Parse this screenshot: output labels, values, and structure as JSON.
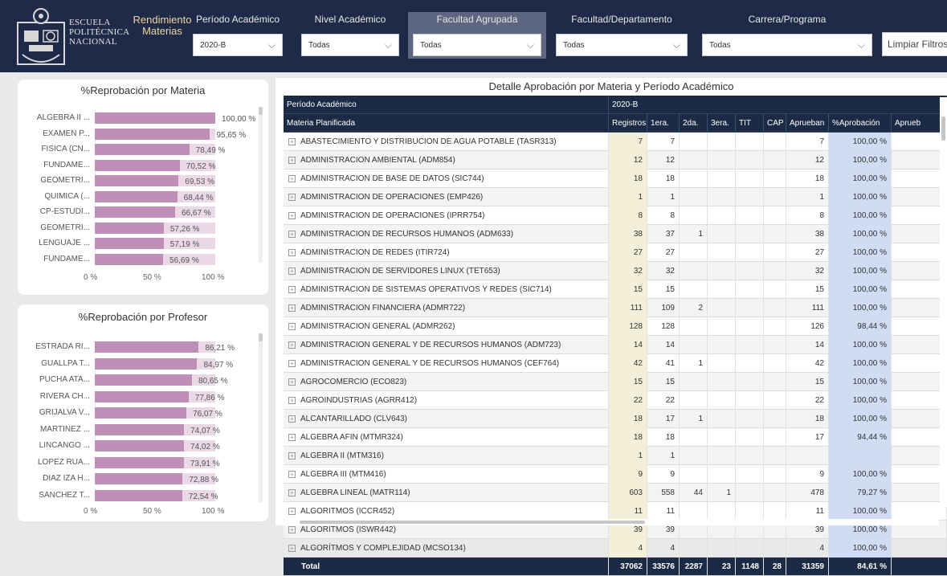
{
  "header": {
    "logo_lines": [
      "ESCUELA",
      "POLITÉCNICA",
      "NACIONAL"
    ],
    "report_title": "Rendimiento Materias",
    "filters": [
      {
        "label": "Período Académico",
        "value": "2020-B"
      },
      {
        "label": "Nivel Académico",
        "value": "Todas"
      },
      {
        "label": "Facultad Agrupada",
        "value": "Todas"
      },
      {
        "label": "Facultad/Departamento",
        "value": "Todas"
      },
      {
        "label": "Carrera/Programa",
        "value": "Todas"
      }
    ],
    "clear_button": "Limpiar Filtros"
  },
  "materia_chart": {
    "title": "%Reprobación por Materia",
    "items": [
      {
        "label": "ALGEBRA II ...",
        "value": 100.0,
        "display": "100,00 %"
      },
      {
        "label": "EXAMEN P...",
        "value": 95.65,
        "display": "95,65 %"
      },
      {
        "label": "FISICA (CN...",
        "value": 78.49,
        "display": "78,49 %"
      },
      {
        "label": "FUNDAME...",
        "value": 70.52,
        "display": "70,52 %"
      },
      {
        "label": "GEOMETRI...",
        "value": 69.53,
        "display": "69,53 %"
      },
      {
        "label": "QUIMICA (...",
        "value": 68.44,
        "display": "68,44 %"
      },
      {
        "label": "CP-ESTUDI...",
        "value": 66.67,
        "display": "66,67 %"
      },
      {
        "label": "GEOMETRI...",
        "value": 57.26,
        "display": "57,26 %"
      },
      {
        "label": "LENGUAJE ...",
        "value": 57.19,
        "display": "57,19 %"
      },
      {
        "label": "FUNDAME...",
        "value": 56.69,
        "display": "56,69 %"
      }
    ],
    "axis": [
      "0 %",
      "50 %",
      "100 %"
    ]
  },
  "profesor_chart": {
    "title": "%Reprobación por Profesor",
    "items": [
      {
        "label": "ESTRADA RI...",
        "value": 86.21,
        "display": "86,21 %"
      },
      {
        "label": "GUALLPA T...",
        "value": 84.97,
        "display": "84,97 %"
      },
      {
        "label": "PUCHA ATA...",
        "value": 80.65,
        "display": "80,65 %"
      },
      {
        "label": "RIVERA CH...",
        "value": 77.86,
        "display": "77,86 %"
      },
      {
        "label": "GRIJALVA V...",
        "value": 76.07,
        "display": "76,07 %"
      },
      {
        "label": "MARTINEZ ...",
        "value": 74.07,
        "display": "74,07 %"
      },
      {
        "label": "LINCANGO ...",
        "value": 74.02,
        "display": "74,02 %"
      },
      {
        "label": "LOPEZ RUA...",
        "value": 73.91,
        "display": "73,91 %"
      },
      {
        "label": "DIAZ IZA H...",
        "value": 72.88,
        "display": "72,88 %"
      },
      {
        "label": "SANCHEZ T...",
        "value": 72.54,
        "display": "72,54 %"
      }
    ],
    "axis": [
      "0 %",
      "50 %",
      "100 %"
    ]
  },
  "table": {
    "title": "Detalle Aprobación por Materia y Período Académico",
    "period_header": "Período Académico",
    "period_value": "2020-B",
    "columns": [
      "Materia Planificada",
      "Registros",
      "1era.",
      "2da.",
      "3era.",
      "TIT",
      "CAP",
      "Aprueban",
      "%Aprobación",
      "Aprueb"
    ],
    "rows": [
      [
        "ABASTECIMIENTO Y DISTRIBUCION DE AGUA POTABLE (TASR313)",
        "7",
        "7",
        "",
        "",
        "",
        "",
        "7",
        "100,00 %"
      ],
      [
        "ADMINISTRACION AMBIENTAL (ADM854)",
        "12",
        "12",
        "",
        "",
        "",
        "",
        "12",
        "100,00 %"
      ],
      [
        "ADMINISTRACION DE BASE DE DATOS (SIC744)",
        "18",
        "18",
        "",
        "",
        "",
        "",
        "18",
        "100,00 %"
      ],
      [
        "ADMINISTRACION DE OPERACIONES (EMP426)",
        "1",
        "1",
        "",
        "",
        "",
        "",
        "1",
        "100,00 %"
      ],
      [
        "ADMINISTRACION DE OPERACIONES (IPRR754)",
        "8",
        "8",
        "",
        "",
        "",
        "",
        "8",
        "100,00 %"
      ],
      [
        "ADMINISTRACION DE RECURSOS HUMANOS (ADM633)",
        "38",
        "37",
        "1",
        "",
        "",
        "",
        "38",
        "100,00 %"
      ],
      [
        "ADMINISTRACION DE REDES (ITIR724)",
        "27",
        "27",
        "",
        "",
        "",
        "",
        "27",
        "100,00 %"
      ],
      [
        "ADMINISTRACION DE SERVIDORES LINUX (TET653)",
        "32",
        "32",
        "",
        "",
        "",
        "",
        "32",
        "100,00 %"
      ],
      [
        "ADMINISTRACION DE SISTEMAS OPERATIVOS Y REDES (SIC714)",
        "15",
        "15",
        "",
        "",
        "",
        "",
        "15",
        "100,00 %"
      ],
      [
        "ADMINISTRACION FINANCIERA (ADMR722)",
        "111",
        "109",
        "2",
        "",
        "",
        "",
        "111",
        "100,00 %"
      ],
      [
        "ADMINISTRACION GENERAL (ADMR262)",
        "128",
        "128",
        "",
        "",
        "",
        "",
        "126",
        "98,44 %"
      ],
      [
        "ADMINISTRACION GENERAL Y DE RECURSOS HUMANOS (ADM723)",
        "14",
        "14",
        "",
        "",
        "",
        "",
        "14",
        "100,00 %"
      ],
      [
        "ADMINISTRACION GENERAL Y DE RECURSOS HUMANOS (CEF764)",
        "42",
        "41",
        "1",
        "",
        "",
        "",
        "42",
        "100,00 %"
      ],
      [
        "AGROCOMERCIO (ECO823)",
        "15",
        "15",
        "",
        "",
        "",
        "",
        "15",
        "100,00 %"
      ],
      [
        "AGROINDUSTRIAS (AGRR412)",
        "22",
        "22",
        "",
        "",
        "",
        "",
        "22",
        "100,00 %"
      ],
      [
        "ALCANTARILLADO (CLV643)",
        "18",
        "17",
        "1",
        "",
        "",
        "",
        "18",
        "100,00 %"
      ],
      [
        "ALGEBRA AFIN (MTMR324)",
        "18",
        "18",
        "",
        "",
        "",
        "",
        "17",
        "94,44 %"
      ],
      [
        "ALGEBRA II (MTM316)",
        "1",
        "1",
        "",
        "",
        "",
        "",
        "",
        ""
      ],
      [
        "ALGEBRA III (MTM416)",
        "9",
        "9",
        "",
        "",
        "",
        "",
        "9",
        "100,00 %"
      ],
      [
        "ALGEBRA LINEAL (MATR114)",
        "603",
        "558",
        "44",
        "1",
        "",
        "",
        "478",
        "79,27 %"
      ],
      [
        "ALGORITMOS (ICCR452)",
        "11",
        "11",
        "",
        "",
        "",
        "",
        "11",
        "100,00 %"
      ],
      [
        "ALGORITMOS (ISWR442)",
        "39",
        "39",
        "",
        "",
        "",
        "",
        "39",
        "100,00 %"
      ],
      [
        "ALGORÍTMOS Y COMPLEJIDAD (MCSO134)",
        "4",
        "4",
        "",
        "",
        "",
        "",
        "4",
        "100,00 %"
      ]
    ],
    "total": [
      "Total",
      "37062",
      "33576",
      "2287",
      "23",
      "1148",
      "28",
      "31359",
      "84,61 %"
    ]
  },
  "colors": {
    "header_bg": "#1e2a48",
    "bar": "#c08fb7",
    "bar_track": "#ead8e6",
    "registros_bg": "#f4efd8",
    "aprobacion_bg": "#cfdcf3"
  }
}
